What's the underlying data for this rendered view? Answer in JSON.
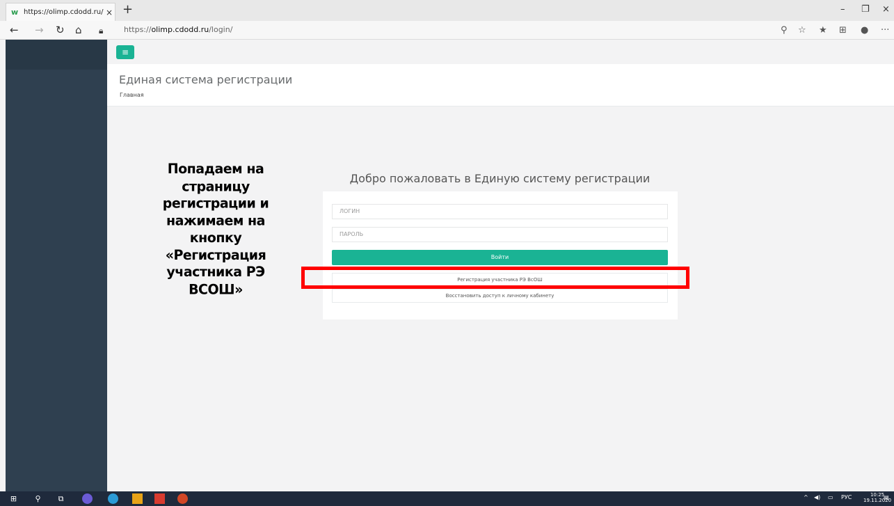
{
  "browser": {
    "tab_title": "https://olimp.cdodd.ru/login/",
    "tab_close": "×",
    "new_tab": "+",
    "url_prefix": "https://",
    "url_host": "olimp.cdodd.ru",
    "url_path": "/login/",
    "window_controls": {
      "minimize": "–",
      "maximize": "❐",
      "close": "×"
    },
    "nav": {
      "back": "←",
      "forward": "→",
      "refresh": "↻",
      "home": "⌂"
    },
    "toolbar_icons": [
      "search-icon",
      "star-icon",
      "favorites-icon",
      "collections-icon",
      "profile-icon",
      "more-icon"
    ],
    "more": "···"
  },
  "page": {
    "menu_icon": "≡",
    "title": "Единая система регистрации",
    "breadcrumb": "Главная",
    "instruction": "Попадаем на страницу регистрации и нажимаем на кнопку «Регистрация участника РЭ ВСОШ»",
    "welcome": "Добро пожаловать в Единую систему регистрации",
    "login_placeholder": "ЛОГИН",
    "password_placeholder": "ПАРОЛЬ",
    "login_button": "Войти",
    "register_link": "Регистрация участника РЭ ВсОШ",
    "restore_link": "Восстановить доступ к личному кабинету",
    "colors": {
      "accent": "#1ab394",
      "sidebar": "#2f4050",
      "highlight": "#ff0000"
    }
  },
  "taskbar": {
    "lang": "РУС",
    "time": "10:25",
    "date": "19.11.2020"
  }
}
